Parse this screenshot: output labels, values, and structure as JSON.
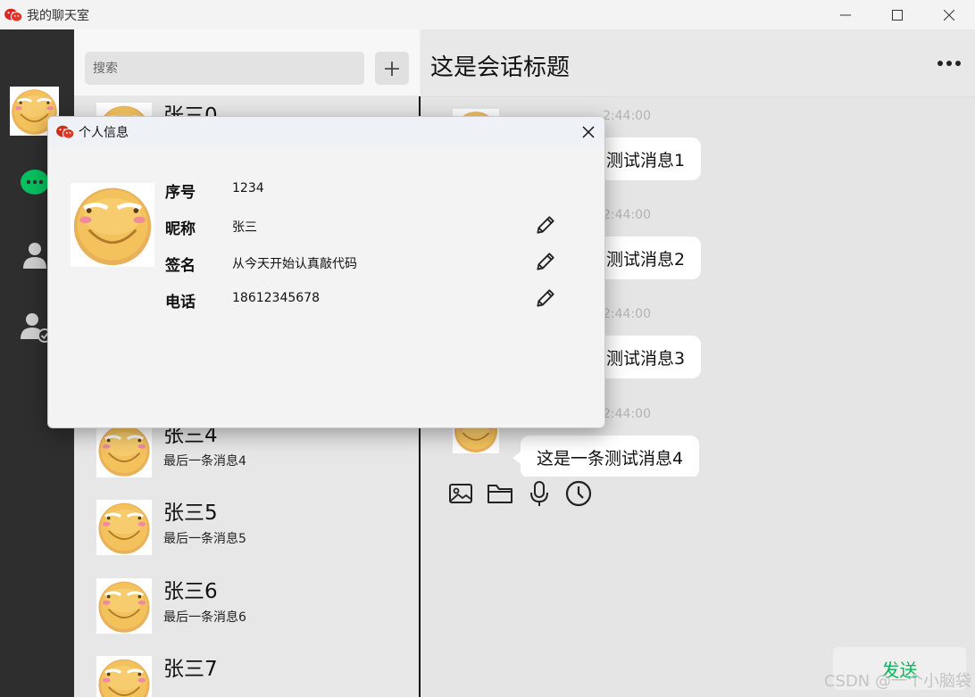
{
  "window": {
    "title": "我的聊天室"
  },
  "search": {
    "placeholder": "搜索"
  },
  "sessions": [
    {
      "name": "张三0",
      "last": ""
    },
    {
      "name": "张三4",
      "last": "最后一条消息4"
    },
    {
      "name": "张三5",
      "last": "最后一条消息5"
    },
    {
      "name": "张三6",
      "last": "最后一条消息6"
    },
    {
      "name": "张三7",
      "last": ""
    }
  ],
  "chat": {
    "title": "这是会话标题",
    "messages": [
      {
        "meta": "2:44:00",
        "text": "测试消息1"
      },
      {
        "meta": "2:44:00",
        "text": "测试消息2"
      },
      {
        "meta": "2:44:00",
        "text": "测试消息3"
      },
      {
        "meta": "2:44:00",
        "text": "这是一条测试消息4"
      }
    ],
    "send_label": "发送"
  },
  "watermark": "CSDN @一个小脑袋",
  "dialog": {
    "title": "个人信息",
    "fields": [
      {
        "label": "序号",
        "value": "1234",
        "editable": false
      },
      {
        "label": "昵称",
        "value": "张三",
        "editable": true
      },
      {
        "label": "签名",
        "value": "从今天开始认真敲代码",
        "editable": true
      },
      {
        "label": "电话",
        "value": "18612345678",
        "editable": true
      }
    ]
  },
  "colors": {
    "nav_bg": "#2e2e2e",
    "wechat_green": "#07c160",
    "send_text": "#0fb45c"
  },
  "icons": [
    "app-logo-icon",
    "minimize-icon",
    "maximize-icon",
    "close-icon",
    "chat-icon",
    "contact-icon",
    "apply-icon",
    "plus-icon",
    "more-icon",
    "image-icon",
    "folder-icon",
    "mic-icon",
    "history-icon",
    "edit-icon"
  ]
}
